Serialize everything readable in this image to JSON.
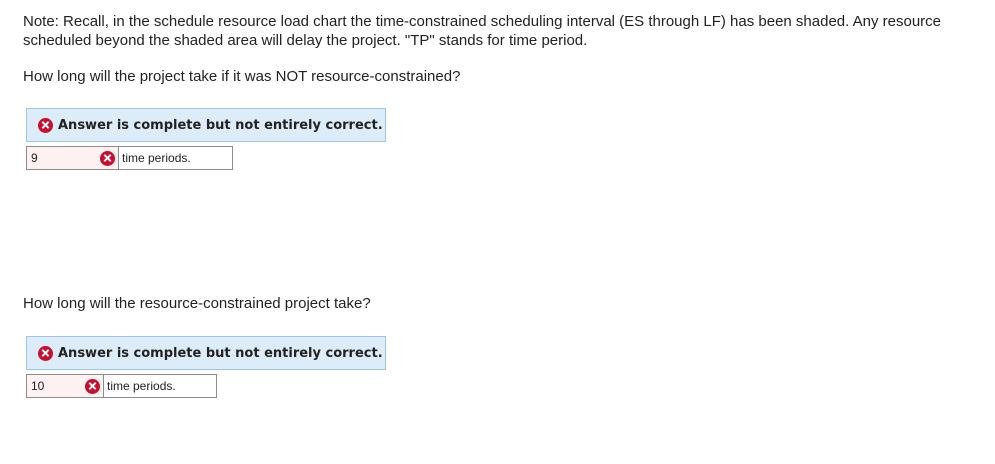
{
  "note": "Note: Recall, in the schedule resource load chart the time-constrained scheduling interval (ES through LF) has been shaded. Any resource scheduled beyond the shaded area will delay the project. \"TP\" stands for time period.",
  "questions": [
    {
      "prompt": "How long will the project take if it was NOT resource-constrained?",
      "feedback": "Answer is complete but not entirely correct.",
      "answer_value": "9",
      "unit_label": "time periods."
    },
    {
      "prompt": "How long will the resource-constrained project take?",
      "feedback": "Answer is complete but not entirely correct.",
      "answer_value": "10",
      "unit_label": "time periods."
    }
  ],
  "icons": {
    "feedback_icon": "incorrect-x-icon",
    "field_icon": "incorrect-x-icon"
  },
  "colors": {
    "error_red": "#c8102e",
    "feedback_bg": "#dcecf9",
    "feedback_border": "#9ec5e6",
    "input_error_bg": "#fdf1f1"
  }
}
